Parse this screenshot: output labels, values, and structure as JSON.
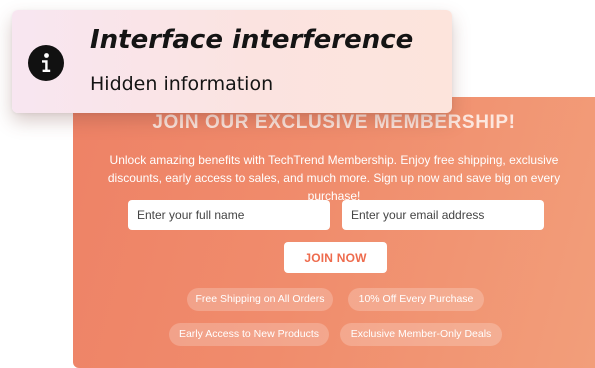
{
  "overlay": {
    "icon": "info-icon",
    "title": "Interface interference",
    "subtitle": "Hidden information"
  },
  "membership": {
    "title": "JOIN OUR EXCLUSIVE MEMBERSHIP!",
    "description": "Unlock amazing benefits with TechTrend Membership. Enjoy free shipping, exclusive discounts, early access to sales, and much more. Sign up now and save big on every purchase!",
    "name_field": {
      "placeholder": "Enter your full name",
      "value": ""
    },
    "email_field": {
      "placeholder": "Enter your email address",
      "value": ""
    },
    "join_button": "JOIN NOW",
    "benefits": [
      "Free Shipping on All Orders",
      "10% Off Every Purchase",
      "Early Access to New Products",
      "Exclusive Member-Only Deals"
    ]
  },
  "colors": {
    "banner_gradient_start": "#ee8266",
    "banner_gradient_end": "#f29e7a",
    "button_text": "#ee6b4d",
    "overlay_gradient_start": "#f8e6f1",
    "overlay_gradient_end": "#fde4dc",
    "icon_fill": "#111111"
  }
}
